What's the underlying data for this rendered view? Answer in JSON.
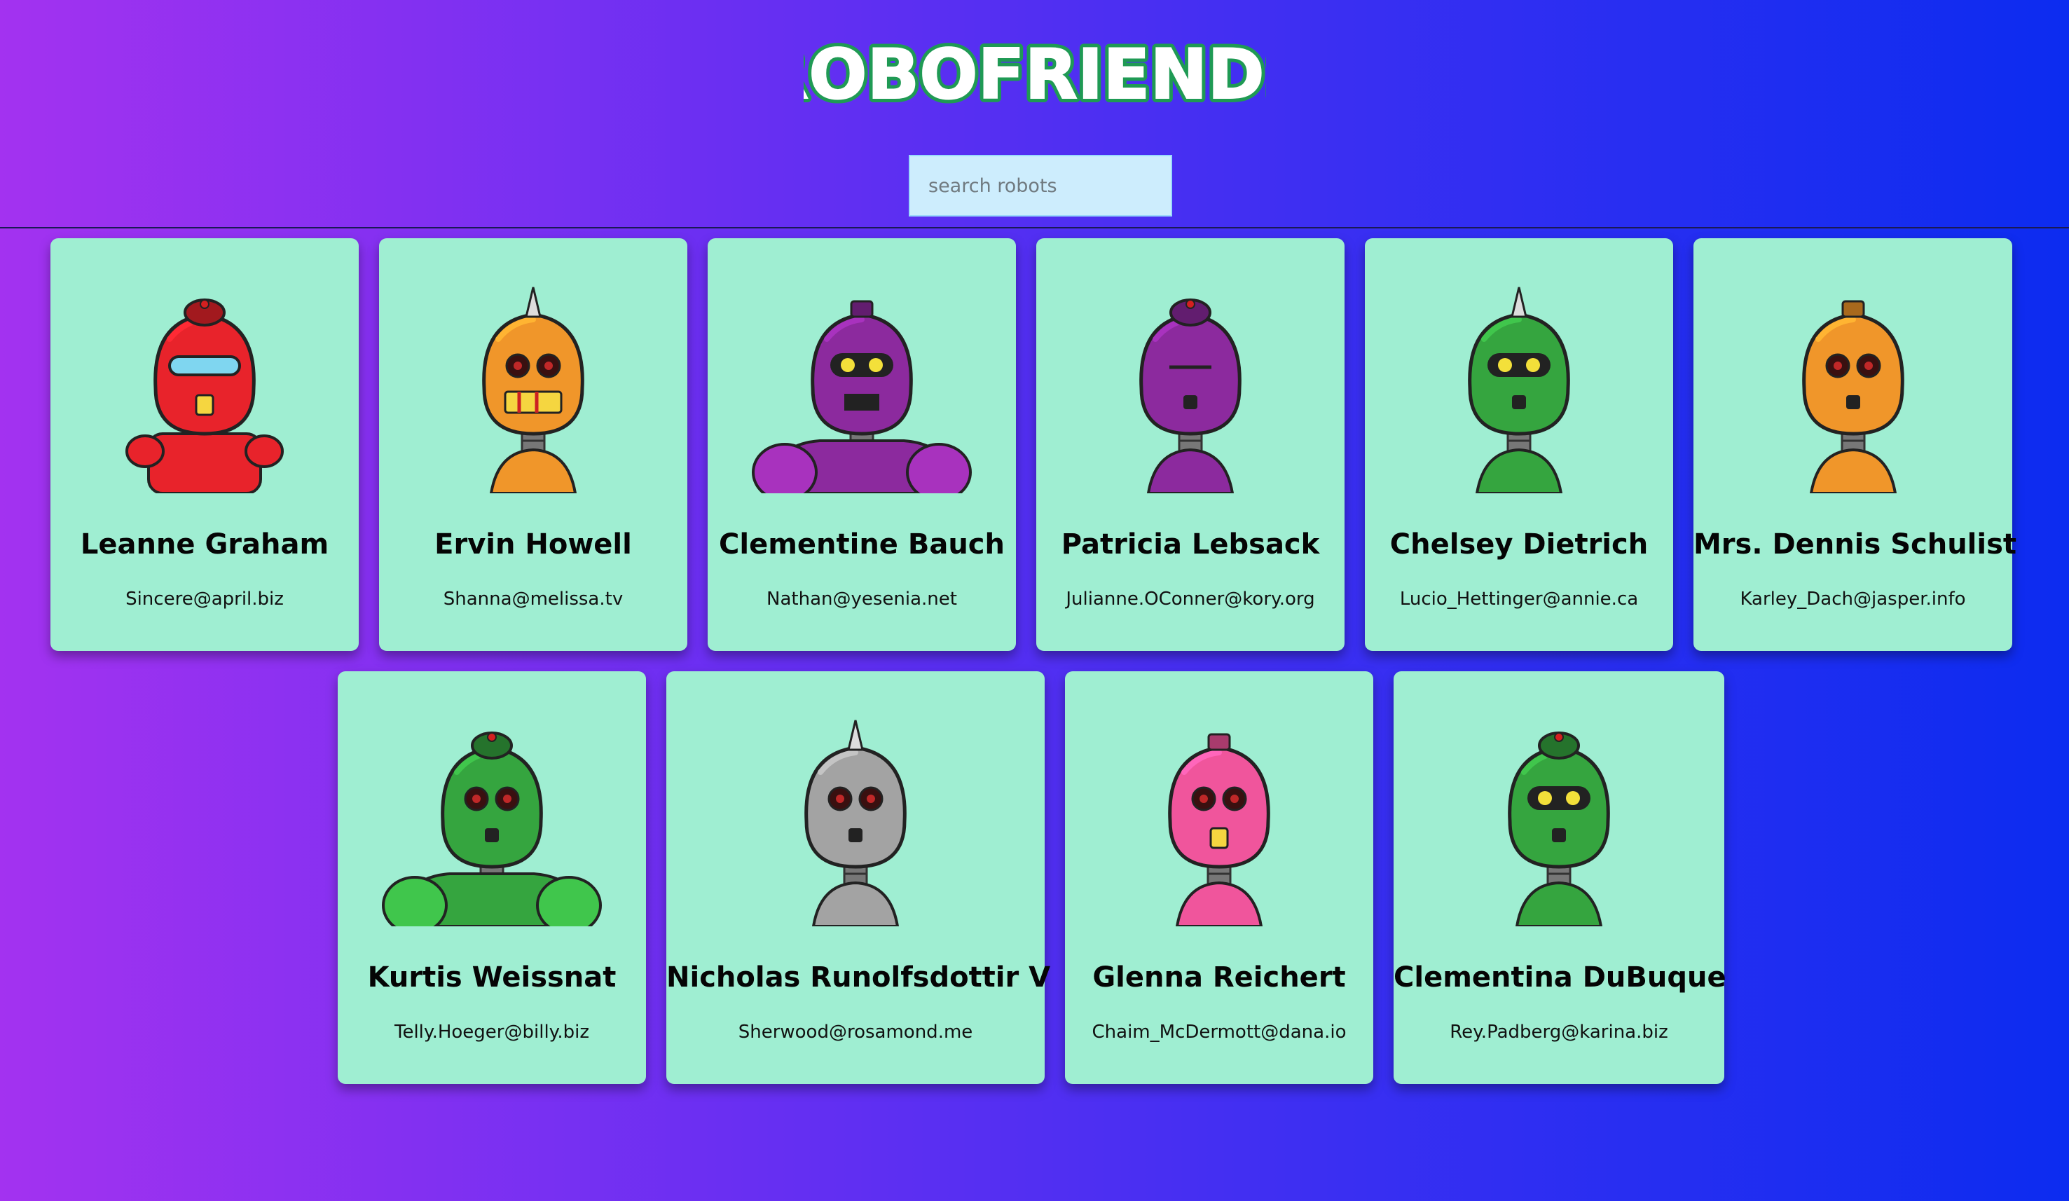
{
  "app": {
    "title": "ROBOFRIENDS"
  },
  "search": {
    "placeholder": "search robots",
    "value": ""
  },
  "robots": [
    {
      "name": "Leanne Graham",
      "email": "Sincere@april.biz",
      "color": "#e8232b"
    },
    {
      "name": "Ervin Howell",
      "email": "Shanna@melissa.tv",
      "color": "#f0962a"
    },
    {
      "name": "Clementine Bauch",
      "email": "Nathan@yesenia.net",
      "color": "#8c2a9e"
    },
    {
      "name": "Patricia Lebsack",
      "email": "Julianne.OConner@kory.org",
      "color": "#8c2a9e"
    },
    {
      "name": "Chelsey Dietrich",
      "email": "Lucio_Hettinger@annie.ca",
      "color": "#35a53f"
    },
    {
      "name": "Mrs. Dennis Schulist",
      "email": "Karley_Dach@jasper.info",
      "color": "#f0962a"
    },
    {
      "name": "Kurtis Weissnat",
      "email": "Telly.Hoeger@billy.biz",
      "color": "#35a53f"
    },
    {
      "name": "Nicholas Runolfsdottir V",
      "email": "Sherwood@rosamond.me",
      "color": "#a3a3a3"
    },
    {
      "name": "Glenna Reichert",
      "email": "Chaim_McDermott@dana.io",
      "color": "#f0559c"
    },
    {
      "name": "Clementina DuBuque",
      "email": "Rey.Padberg@karina.biz",
      "color": "#35a53f"
    }
  ]
}
